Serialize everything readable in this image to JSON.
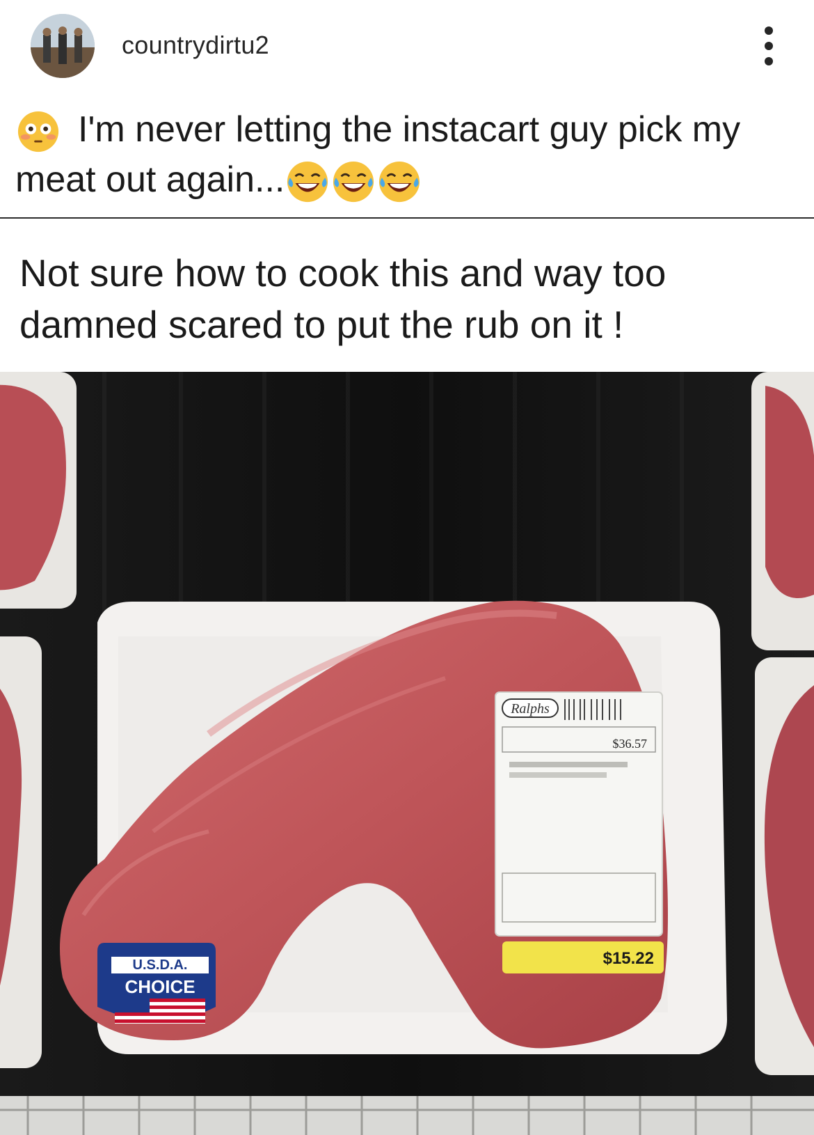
{
  "post": {
    "username": "countrydirtu2",
    "avatar_icon": "avatar-photo-icon",
    "more_icon": "more-options-vertical-icon"
  },
  "caption": {
    "text_before": "I'm never letting the instacart guy pick my meat out again...",
    "emojis": [
      "flushed-face-icon",
      "laughing-tears-icon",
      "laughing-tears-icon",
      "laughing-tears-icon"
    ]
  },
  "shared_post": {
    "text": "Not sure how to cook this and way too damned scared to put the rub on it !"
  },
  "photo": {
    "usda_line1": "U.S.D.A.",
    "usda_line2": "CHOICE",
    "store_label": "Ralphs",
    "price_small": "$36.57",
    "price_tag": "$15.22",
    "colors": {
      "meat": "#c25a5e",
      "tray": "#f2f0ee",
      "background": "#121212",
      "price_sticker": "#f4e64a"
    }
  }
}
